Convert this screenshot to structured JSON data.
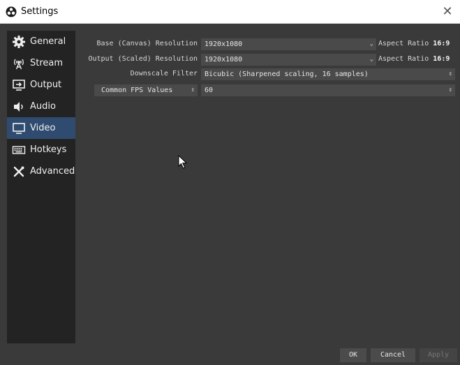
{
  "window": {
    "title": "Settings",
    "close_glyph": "✕"
  },
  "sidebar": {
    "items": [
      {
        "label": "General",
        "icon": "gear-icon",
        "active": false
      },
      {
        "label": "Stream",
        "icon": "broadcast-icon",
        "active": false
      },
      {
        "label": "Output",
        "icon": "output-icon",
        "active": false
      },
      {
        "label": "Audio",
        "icon": "speaker-icon",
        "active": false
      },
      {
        "label": "Video",
        "icon": "monitor-icon",
        "active": true
      },
      {
        "label": "Hotkeys",
        "icon": "keyboard-icon",
        "active": false
      },
      {
        "label": "Advanced",
        "icon": "tools-icon",
        "active": false
      }
    ]
  },
  "video": {
    "base_resolution": {
      "label": "Base (Canvas) Resolution",
      "value": "1920x1080",
      "aspect_prefix": "Aspect Ratio",
      "aspect_value": "16:9"
    },
    "output_resolution": {
      "label": "Output (Scaled) Resolution",
      "value": "1920x1080",
      "aspect_prefix": "Aspect Ratio",
      "aspect_value": "16:9"
    },
    "downscale_filter": {
      "label": "Downscale Filter",
      "value": "Bicubic (Sharpened scaling, 16 samples)"
    },
    "fps": {
      "type_value": "Common FPS Values",
      "value": "60"
    }
  },
  "buttons": {
    "ok": "OK",
    "cancel": "Cancel",
    "apply": "Apply"
  },
  "colors": {
    "active_nav": "#2f4c70",
    "panel_bg": "#3a3a3a",
    "sidebar_bg": "#232323",
    "field_bg": "#4a4a4a"
  }
}
